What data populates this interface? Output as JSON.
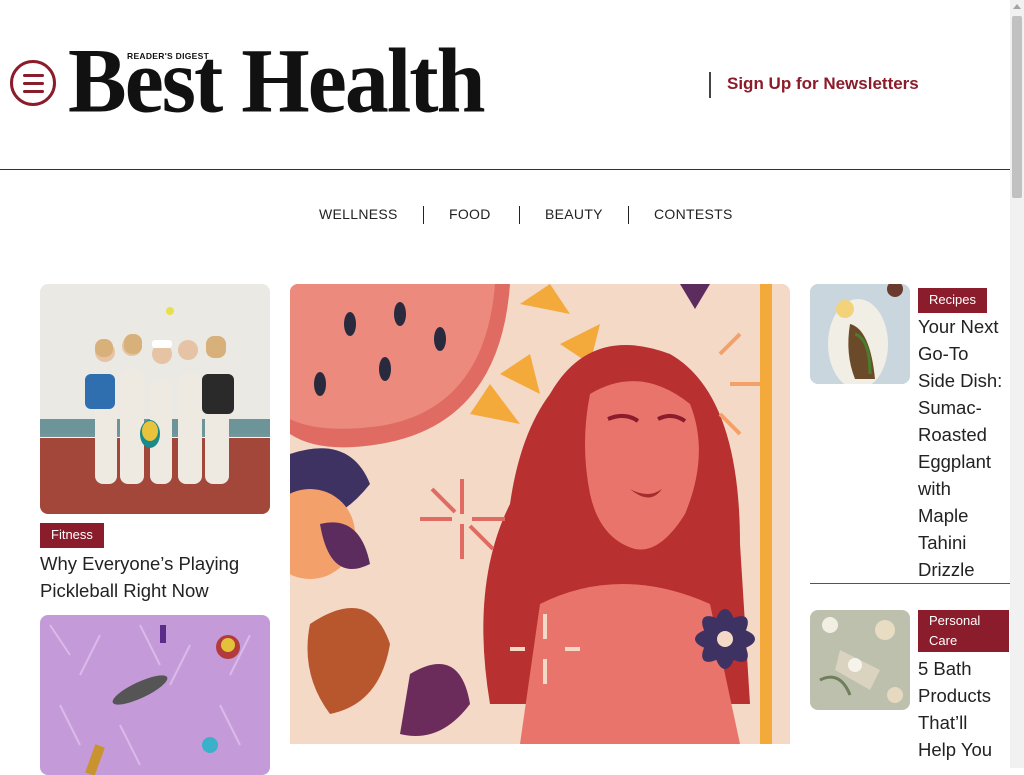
{
  "header": {
    "menu_label": "Menu",
    "kicker": "READER'S DIGEST",
    "brand": "Best Health",
    "newsletter_link": "Sign Up for Newsletters"
  },
  "nav": {
    "items": [
      "WELLNESS",
      "FOOD",
      "BEAUTY",
      "CONTESTS"
    ]
  },
  "left_column": {
    "cards": [
      {
        "tag": "Fitness",
        "headline_line1": "Why Everyone’s Playing",
        "headline_line2": "Pickleball Right Now",
        "image": "women-pickleball-photo"
      },
      {
        "image": "purple-fur-beauty-products-photo"
      }
    ]
  },
  "feature": {
    "image": "woman-illustration-watermelon-flowers"
  },
  "right_column": {
    "cards": [
      {
        "tag": "Recipes",
        "headline_lines": [
          "Your Next",
          "Go-To",
          "Side Dish:",
          "Sumac-",
          "Roasted",
          "Eggplant",
          "with",
          "Maple",
          "Tahini",
          "Drizzle"
        ],
        "image": "roasted-eggplant-photo"
      },
      {
        "tag_line1": "Personal",
        "tag_line2": "Care",
        "headline_lines": [
          "5 Bath",
          "Products",
          "That’ll",
          "Help You"
        ],
        "image": "bath-products-flowers-photo"
      }
    ]
  },
  "colors": {
    "accent": "#8a1c2b",
    "text": "#222222"
  }
}
